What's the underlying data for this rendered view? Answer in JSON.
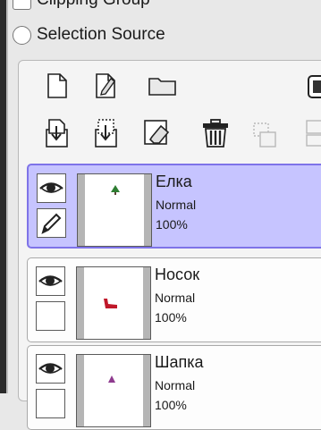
{
  "options": {
    "clipping_group_label": "Clipping Group",
    "selection_source_label": "Selection Source"
  },
  "toolbar": {
    "row1": [
      "new-layer-icon",
      "new-linework-layer-icon",
      "new-folder-icon",
      "layer-color-icon"
    ],
    "row2": [
      "transfer-down-icon",
      "merge-down-icon",
      "clear-layer-icon",
      "delete-layer-icon",
      "merge-selected-icon",
      "combine-icon"
    ]
  },
  "layers": [
    {
      "name": "Елка",
      "blend": "Normal",
      "opacity": "100%",
      "selected": true,
      "thumb_icon": "tree-icon",
      "thumb_color": "#2e7d32"
    },
    {
      "name": "Носок",
      "blend": "Normal",
      "opacity": "100%",
      "selected": false,
      "thumb_icon": "sock-icon",
      "thumb_color": "#c0182a"
    },
    {
      "name": "Шапка",
      "blend": "Normal",
      "opacity": "100%",
      "selected": false,
      "thumb_icon": "hat-icon",
      "thumb_color": "#8e3a8e"
    }
  ]
}
